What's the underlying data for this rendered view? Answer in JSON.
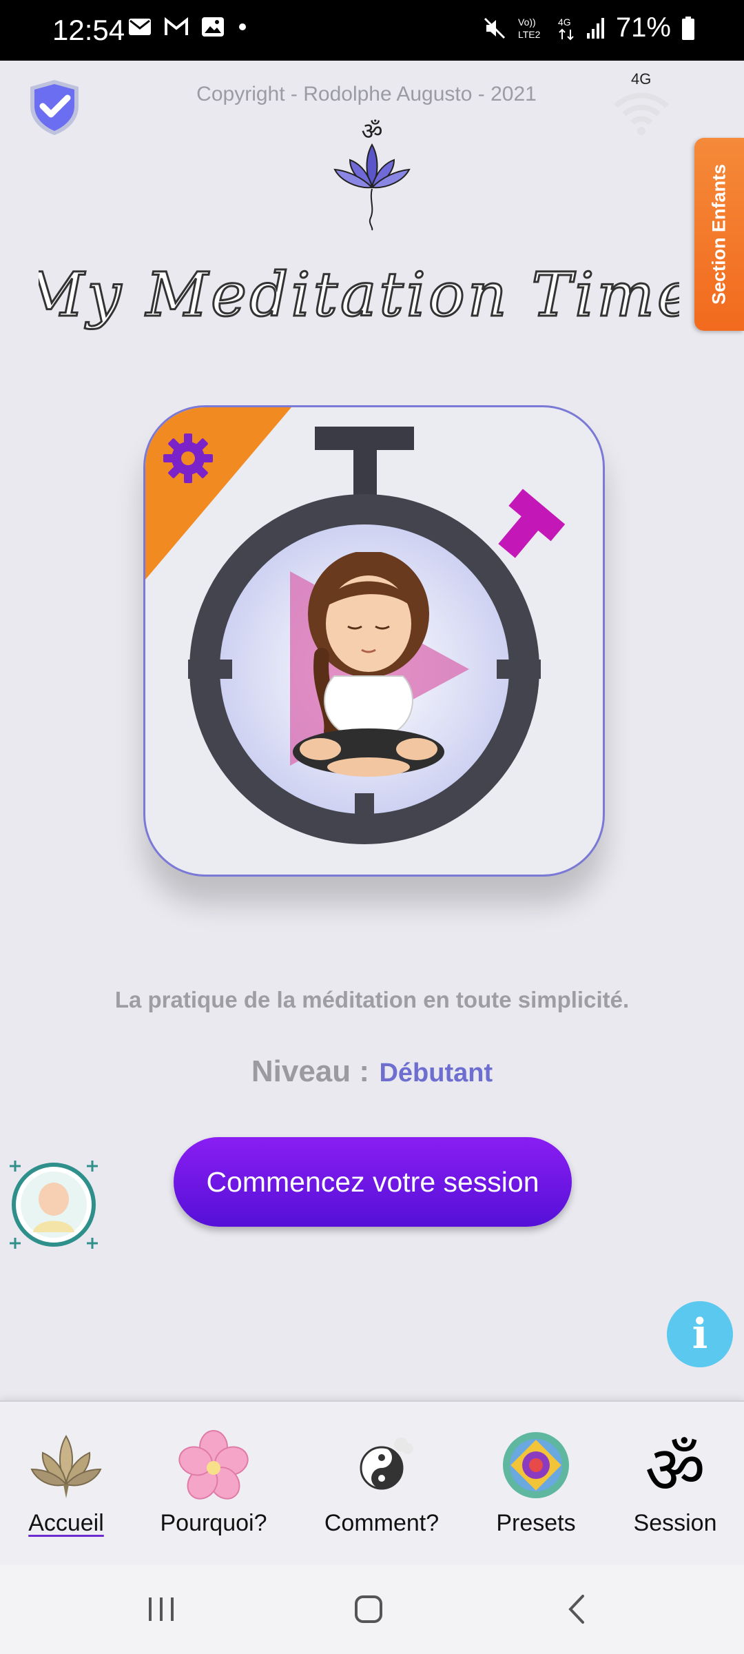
{
  "status_bar": {
    "time": "12:54",
    "battery": "71%",
    "network": "4G",
    "signal": "LTE2"
  },
  "header": {
    "copyright": "Copyright - Rodolphe Augusto - 2021",
    "wifi_label": "4G",
    "title": "My Meditation Time"
  },
  "kids_tab": {
    "label": "Section Enfants"
  },
  "main": {
    "tagline": "La pratique de la méditation en toute simplicité.",
    "level_label": "Niveau :",
    "level_value": "Débutant",
    "start_button": "Commencez votre session"
  },
  "bottom_nav": {
    "items": [
      {
        "label": "Accueil",
        "icon": "lotus-icon",
        "active": true
      },
      {
        "label": "Pourquoi?",
        "icon": "flower-icon",
        "active": false
      },
      {
        "label": "Comment?",
        "icon": "yin-yang-icon",
        "active": false
      },
      {
        "label": "Presets",
        "icon": "mandala-icon",
        "active": false
      },
      {
        "label": "Session",
        "icon": "om-icon",
        "active": false
      }
    ]
  },
  "colors": {
    "accent": "#6a16e0",
    "kids_tab": "#f27a26",
    "info": "#5bc8ef",
    "level": "#6e6ed0"
  }
}
